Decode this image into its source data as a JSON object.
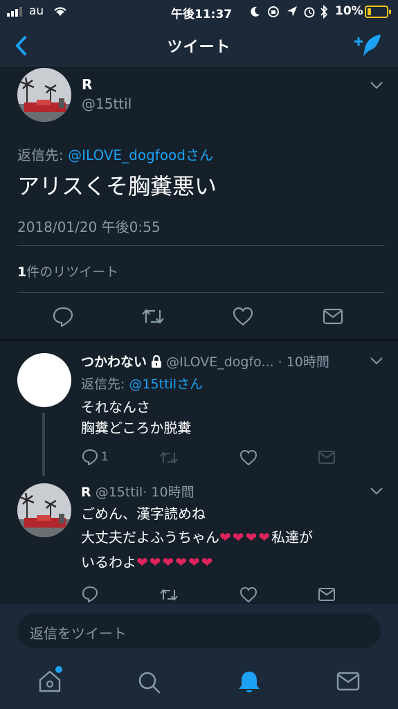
{
  "status_bar": {
    "carrier": "au",
    "time": "午後11:37",
    "battery": "10%"
  },
  "nav": {
    "title": "ツイート",
    "back_icon": "chevron-left-icon",
    "compose_icon": "compose-tweet-icon"
  },
  "main_tweet": {
    "name": "R",
    "handle": "@15ttil",
    "reply_prefix": "返信先: ",
    "reply_to": "@ILOVE_dogfoodさん",
    "text": "アリスくそ胸糞悪い",
    "timestamp": "2018/01/20 午後0:55",
    "retweet_count": "1",
    "retweet_label": "件のリツイート"
  },
  "replies": [
    {
      "name": "つかわない",
      "handle": "@ILOVE_dogfo...",
      "time": "· 10時間",
      "reply_prefix": "返信先: ",
      "reply_to": "@15ttilさん",
      "line1": "それなんさ",
      "line2": "胸糞どころか脱糞",
      "reply_count": "1"
    },
    {
      "name": "R",
      "handle": "@15ttil",
      "time": "· 10時間",
      "line1": "ごめん、漢字読めね",
      "line2a": "大丈夫だよふうちゃん",
      "hearts_a": "❤❤❤❤",
      "line2b": "私達が",
      "line3a": "いるわよ",
      "hearts_b": "❤❤❤❤❤❤"
    }
  ],
  "composer": {
    "placeholder": "返信をツイート"
  },
  "colors": {
    "background": "#15202b",
    "bar": "#1c2938",
    "accent": "#1da1f2",
    "muted": "#8899a6",
    "heart": "#e0245e"
  },
  "tabs": [
    "home-icon",
    "search-icon",
    "notifications-icon",
    "messages-icon"
  ]
}
